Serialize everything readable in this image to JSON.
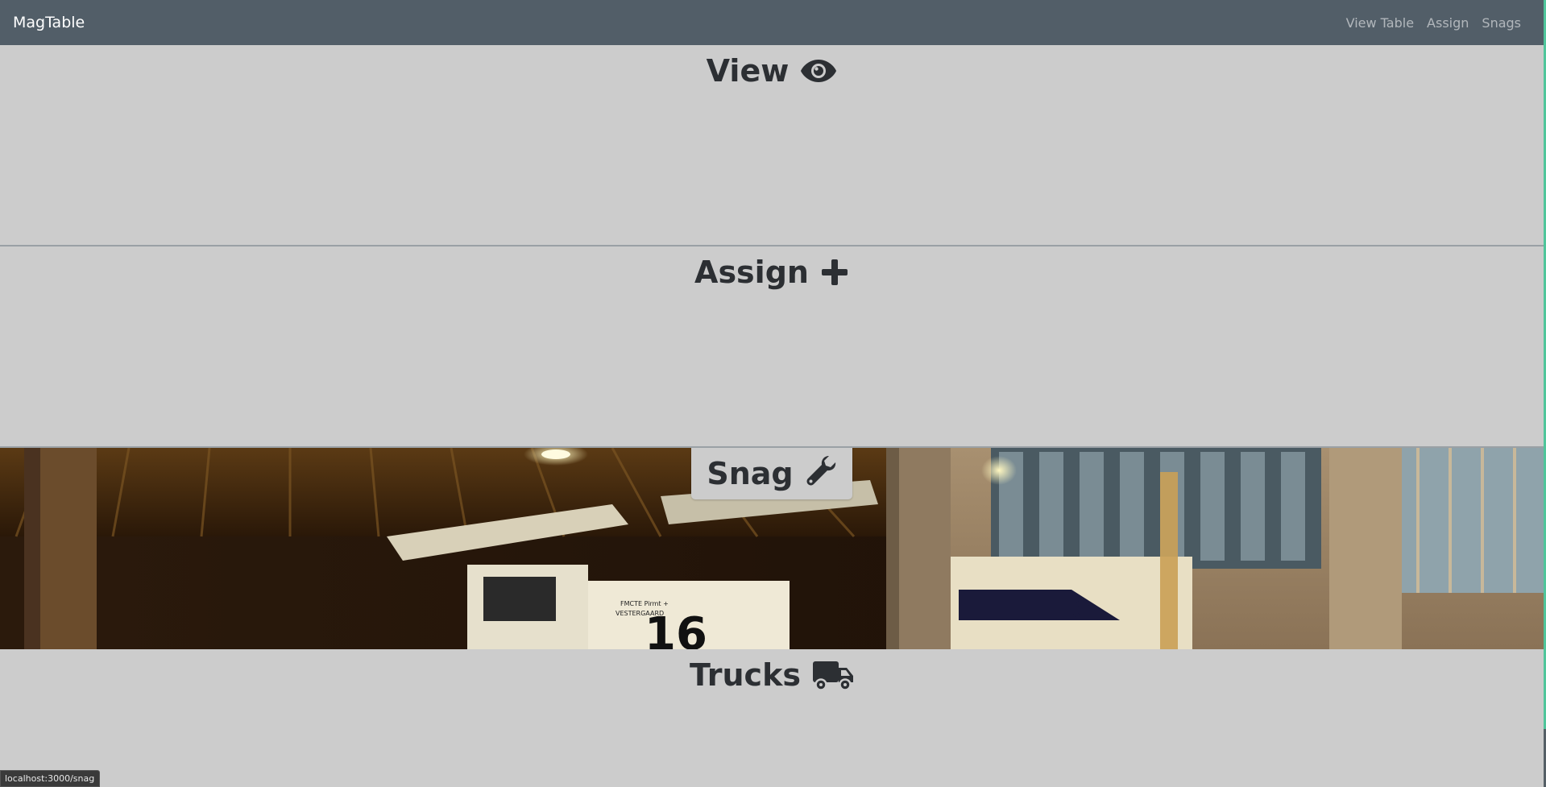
{
  "navbar": {
    "brand": "MagTable",
    "links": [
      "View Table",
      "Assign",
      "Snags"
    ]
  },
  "sections": {
    "view": {
      "title": "View",
      "icon": "eye-icon"
    },
    "assign": {
      "title": "Assign",
      "icon": "plus-icon"
    },
    "snag": {
      "title": "Snag",
      "icon": "wrench-icon",
      "background": "photo-of-deicing-trucks-at-night"
    },
    "trucks": {
      "title": "Trucks",
      "icon": "truck-icon"
    }
  },
  "status_bar": {
    "url": "localhost:3000/snag"
  },
  "colors": {
    "navbar": "#525e68",
    "section_bg": "#cccccc",
    "heading_text": "#2c2f33",
    "scroll_accent": "#4fc59b"
  }
}
